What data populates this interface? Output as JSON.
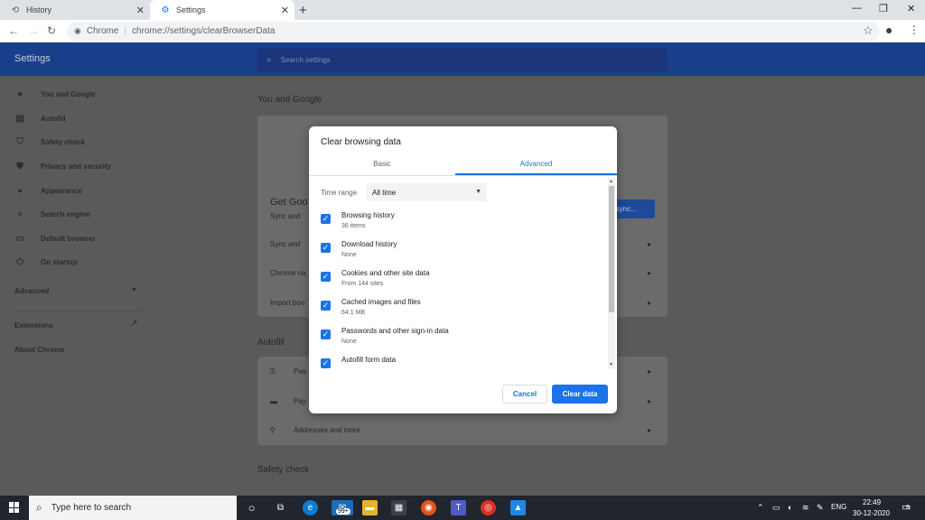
{
  "browser": {
    "tabs": [
      {
        "label": "History",
        "icon": "history-icon"
      },
      {
        "label": "Settings",
        "icon": "gear-icon"
      }
    ],
    "omnibox": {
      "site": "Chrome",
      "separator": "|",
      "path": "chrome://settings/clearBrowserData"
    }
  },
  "settings": {
    "title": "Settings",
    "search_placeholder": "Search settings",
    "nav": [
      {
        "label": "You and Google",
        "icon": "person-icon"
      },
      {
        "label": "Autofill",
        "icon": "clipboard-icon"
      },
      {
        "label": "Safety check",
        "icon": "shield-check-icon"
      },
      {
        "label": "Privacy and security",
        "icon": "shield-icon"
      },
      {
        "label": "Appearance",
        "icon": "palette-icon"
      },
      {
        "label": "Search engine",
        "icon": "search-icon"
      },
      {
        "label": "Default browser",
        "icon": "browser-icon"
      },
      {
        "label": "On startup",
        "icon": "power-icon"
      }
    ],
    "advanced_label": "Advanced",
    "extensions_label": "Extensions",
    "about_label": "About Chrome",
    "sections": {
      "you_and_google": "You and Google",
      "get_goo": "Get Goo",
      "sync_and": "Sync and",
      "sync_and_2": "Sync and",
      "chrome_na": "Chrome na",
      "import_boo": "Import boo",
      "sync_button": "n sync...",
      "autofill": "Autofill",
      "pas": "Pas",
      "pay": "Pay",
      "addresses": "Addresses and more",
      "safety_check": "Safety check"
    }
  },
  "dialog": {
    "title": "Clear browsing data",
    "tabs": {
      "basic": "Basic",
      "advanced": "Advanced"
    },
    "time_range_label": "Time range",
    "time_range_value": "All time",
    "items": [
      {
        "title": "Browsing history",
        "subtitle": "36 items",
        "checked": true
      },
      {
        "title": "Download history",
        "subtitle": "None",
        "checked": true
      },
      {
        "title": "Cookies and other site data",
        "subtitle": "From 144 sites",
        "checked": true
      },
      {
        "title": "Cached images and files",
        "subtitle": "64.1 MB",
        "checked": true
      },
      {
        "title": "Passwords and other sign-in data",
        "subtitle": "None",
        "checked": true
      },
      {
        "title": "Autofill form data",
        "subtitle": "",
        "checked": true
      }
    ],
    "cancel_label": "Cancel",
    "clear_label": "Clear data"
  },
  "taskbar": {
    "search_placeholder": "Type here to search",
    "mail_badge": "99+",
    "lang": "ENG",
    "time": "22:49",
    "date": "30-12-2020",
    "notification_count": "8"
  },
  "colors": {
    "accent": "#1a73e8",
    "header": "#1a3f8a",
    "overlay": "#5a5a5a"
  }
}
